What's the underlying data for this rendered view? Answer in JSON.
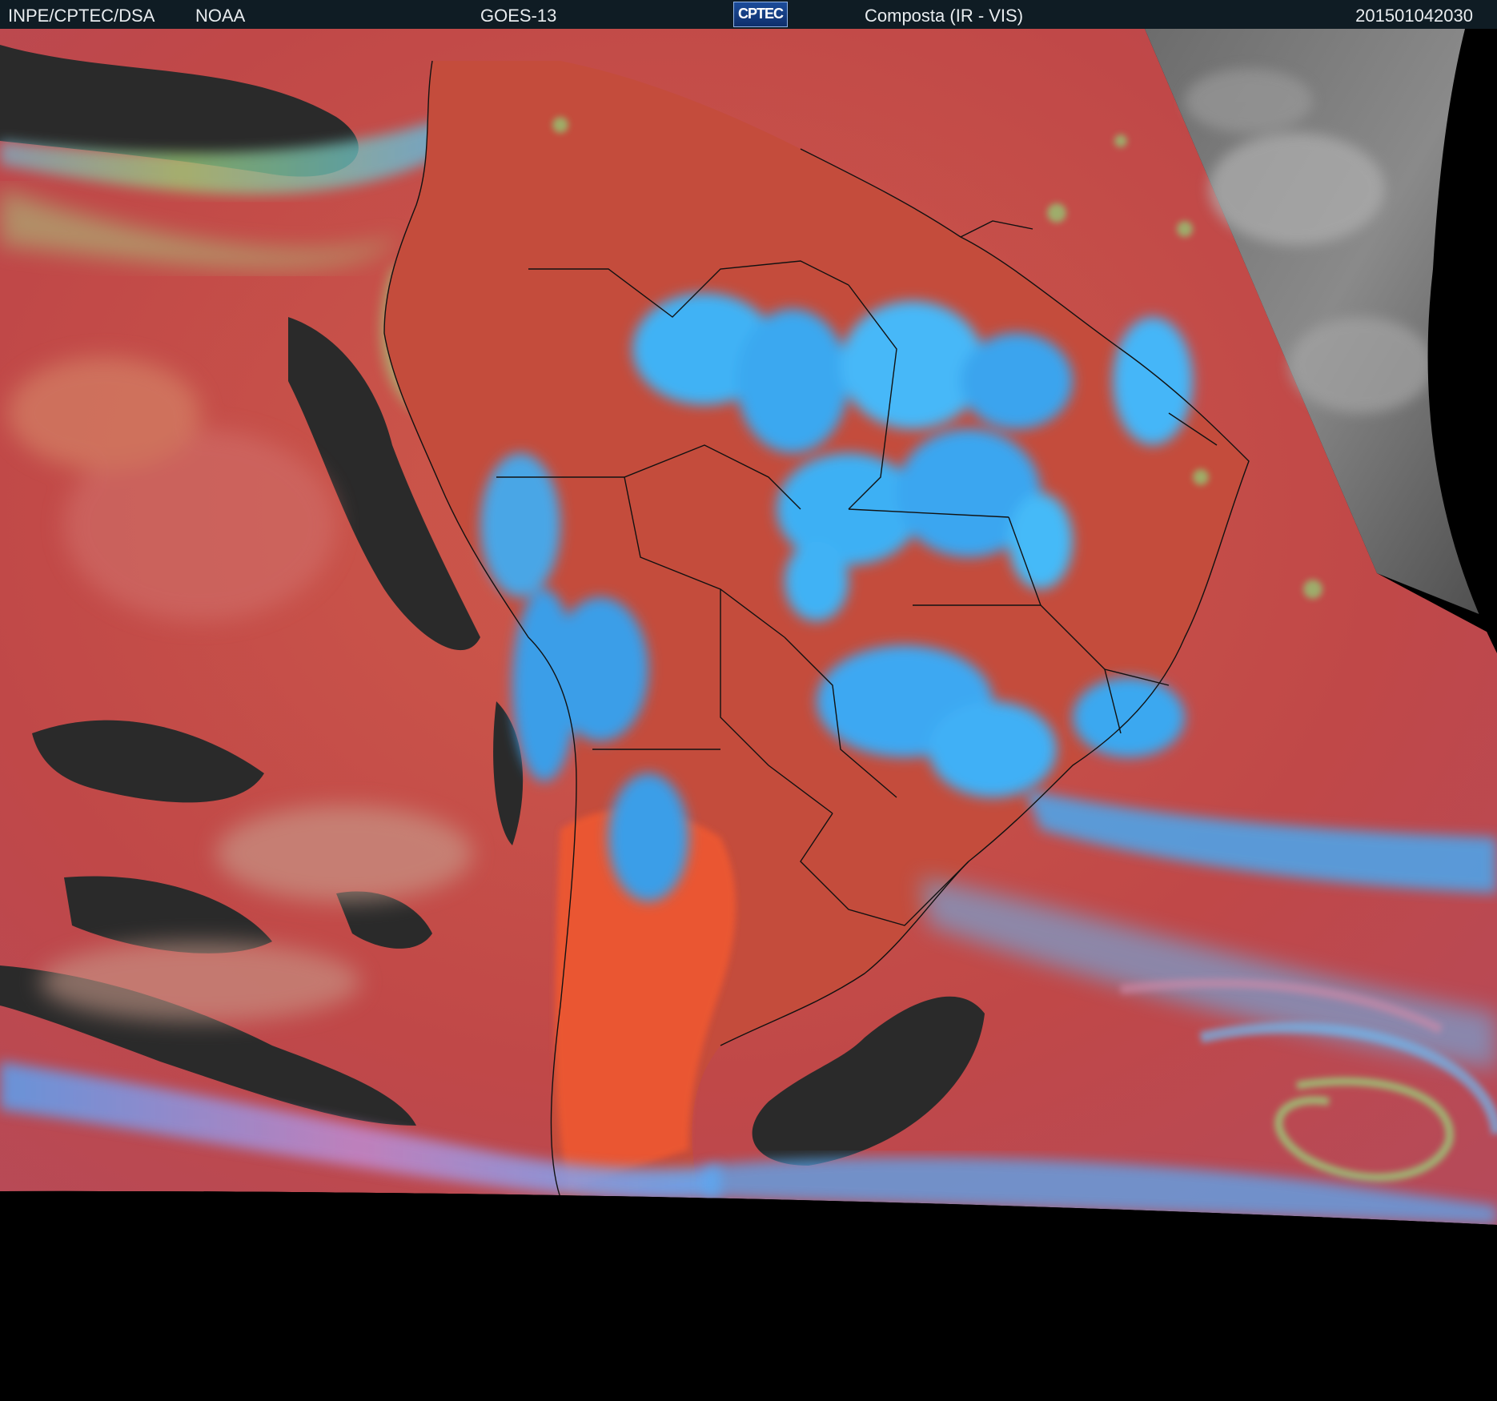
{
  "header": {
    "agency": "INPE/CPTEC/DSA",
    "partner": "NOAA",
    "satellite": "GOES-13",
    "logo_text": "CPTEC",
    "product": "Composta (IR - VIS)",
    "timestamp": "201501042030"
  },
  "imagery": {
    "palette": {
      "background": "#000000",
      "ocean_warm": "#c44a4a",
      "land_hot": "#e4502c",
      "deep_convection": "#3aa6f2",
      "clear_sky_dark": "#2a2a2a",
      "high_cloud_green": "#9ad07a",
      "visible_gray": "#7a7a7a",
      "borders": "#101010"
    }
  }
}
